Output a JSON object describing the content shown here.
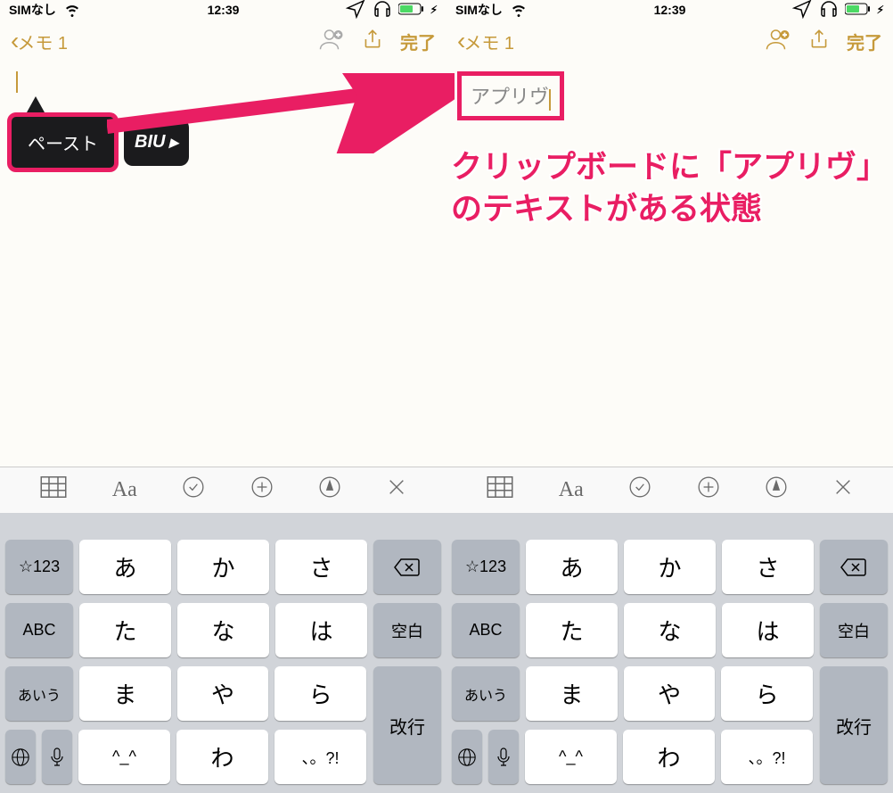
{
  "status": {
    "carrier": "SIMなし",
    "time": "12:39"
  },
  "nav": {
    "back_label": "メモ 1",
    "done_label": "完了"
  },
  "left_phone": {
    "paste_label": "ペースト",
    "format_label": "BIU"
  },
  "right_phone": {
    "pasted_text": "アプリヴ"
  },
  "caption": {
    "line1": "クリップボードに「アプリヴ」",
    "line2": "のテキストがある状態"
  },
  "toolbar": {
    "aa": "Aa"
  },
  "keyboard": {
    "row1": {
      "side_l": "☆123",
      "k1": "あ",
      "k2": "か",
      "k3": "さ",
      "side_r": "⌫"
    },
    "row2": {
      "side_l": "ABC",
      "k1": "た",
      "k2": "な",
      "k3": "は",
      "side_r": "空白"
    },
    "row3": {
      "side_l": "あいう",
      "k1": "ま",
      "k2": "や",
      "k3": "ら"
    },
    "row4": {
      "k1": "^_^",
      "k2": "わ",
      "k3": "、。?!"
    },
    "return_label": "改行"
  }
}
